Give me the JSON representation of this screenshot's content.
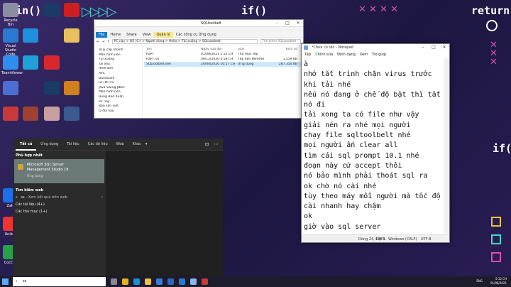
{
  "desktop": {
    "deco": {
      "left_code": "main()",
      "center_code": "if()",
      "right_code": "return()",
      "right_side": "if()"
    },
    "icons": [
      {
        "label": "Recycle Bin",
        "color": "#8a8fa0"
      },
      {
        "label": "Visual Studio Code",
        "color": "#2a7ad1"
      },
      {
        "label": "TeamViewer",
        "color": "#2e8ef0"
      },
      {
        "label": "Zalo",
        "color": "#1a70e8"
      },
      {
        "label": "Unikey",
        "color": "#e33"
      },
      {
        "label": "CocCoc",
        "color": "#2aa04a"
      },
      {
        "label": "Microsoft Edge",
        "color": "#1b8fd6"
      }
    ]
  },
  "explorer": {
    "title": "SQLtoolbelt",
    "tabs": [
      "File",
      "Home",
      "Share",
      "View",
      "Application Tools"
    ],
    "manage": "Quản lý",
    "ribbon_sub": "Các công cụ Ứng dụng",
    "path": "PC này  >  OS (C:)  >  Người dùng  >  Hello  >  Tải xuống  >  SQLtoolbelt",
    "search_placeholder": "Tìm kiếm SQLtoolbelt",
    "nav": [
      "Truy cập nhanh",
      "Màn hình nền",
      "Tải xuống",
      "Tài liệu",
      "Hình ảnh",
      "AVC",
      "Bandicam",
      "GTTM-ITS",
      "Java Swing JBDC",
      "Màn hình nền",
      "Hùng Bảo Xuân",
      "PC này",
      "Bản sàn việt",
      "Ổ đĩa này"
    ],
    "headers": {
      "name": "Tên",
      "date": "Ngày sửa đổi",
      "type": "Loại",
      "size": "Kích cỡ"
    },
    "files": [
      {
        "name": "RaPT",
        "date": "01/08/2021 5:52 CH",
        "type": "Thư mục tệp",
        "size": ""
      },
      {
        "name": "RaPT.rar",
        "date": "09/12/2020 4:58 CH",
        "type": "Tệp nén WinRAR",
        "size": "1.559 KB"
      },
      {
        "name": "SQLToolbelt.exe",
        "date": "26/04/2020 10:57 CH",
        "type": "Ứng dụng",
        "size": "287.350 KB"
      }
    ]
  },
  "notepad": {
    "title": "*Chưa có tên - Notepad",
    "menu": [
      "Tệp",
      "Chỉnh sửa",
      "Định dạng",
      "Xem",
      "Trợ giúp"
    ],
    "lines": [
      "à",
      "nhớ tắt trình chặn virus trước",
      "khi tải nhé",
      "nếu nó đang ở chế độ bật thì tắt",
      "nó đi",
      "tải xong ta có file như vậy",
      "giải nén ra nhé mọi người",
      "chạy file sqltoolbelt nhé",
      "mọi người ấn clear all",
      "tìm cái sql prompt 10.1 nhé",
      "đoạn này cứ accept thôi",
      "nó bảo mình phải thoát sql ra",
      "ok chờ nó cài nhé",
      "tùy theo máy mỗi người mà tốc độ",
      "cài nhanh hay chậm",
      "ok",
      "giờ vào sql server"
    ],
    "status": {
      "position": "Dòng 24, Cột 1",
      "zoom": "100%",
      "eol": "Windows (CRLF)",
      "encoding": "UTF-8"
    }
  },
  "startmenu": {
    "tabs": [
      "Tất cả",
      "Ứng dụng",
      "Tài liệu",
      "Các tài liệu",
      "Web",
      "Khác"
    ],
    "best_match_header": "Phù hợp nhất",
    "best_match": {
      "name": "Microsoft SQL Server Management Studio 18",
      "type": "Ứng dụng"
    },
    "web_header": "Tìm kiếm web",
    "web_query": "ss",
    "web_hint": "- Xem kết quả trên web",
    "docs": "Các tài liệu (4+)",
    "folders": "Các thư mục (1+)"
  },
  "taskbar": {
    "search_value": "ss",
    "time": "5:12 CH",
    "date": "01/08/2021",
    "lang": "ENG"
  }
}
